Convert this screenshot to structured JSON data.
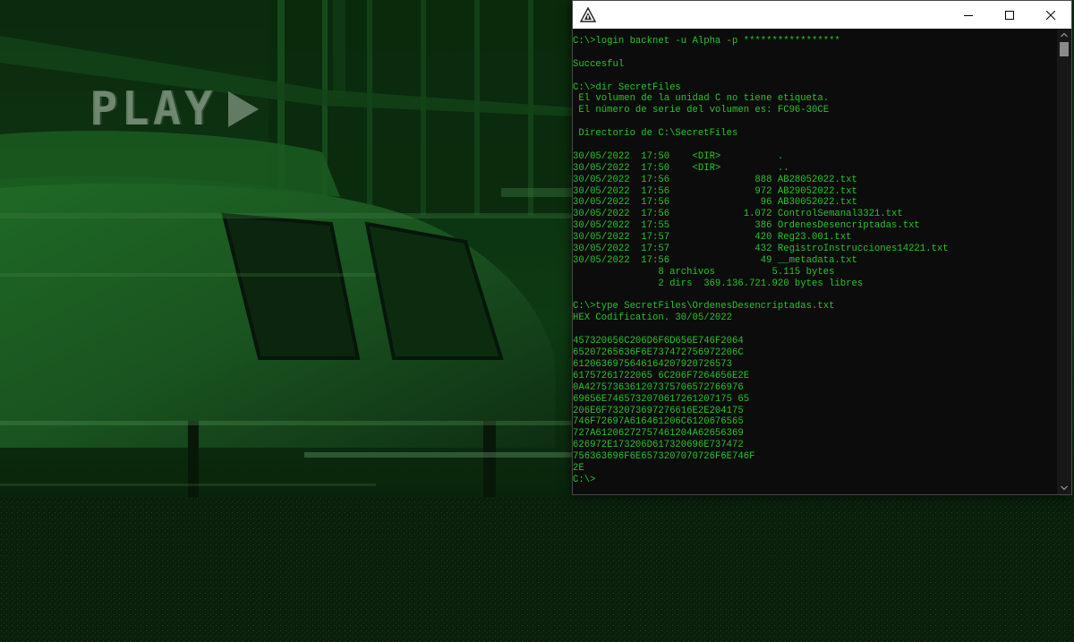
{
  "background": {
    "overlay_text": "PLAY",
    "overlay_icon": "play-triangle-icon",
    "tint": "#0b3a10"
  },
  "console": {
    "app_icon": "triangle-app-icon",
    "controls": {
      "minimize_icon": "minimize-icon",
      "maximize_icon": "maximize-icon",
      "close_icon": "close-icon"
    },
    "text_color": "#27c52b",
    "background_color": "#0c0c0c",
    "lines": [
      "C:\\>login backnet -u Alpha -p *****************",
      "",
      "Succesful",
      "",
      "C:\\>dir SecretFiles",
      " El volumen de la unidad C no tiene etiqueta.",
      " El número de serie del volumen es: FC96-30CE",
      "",
      " Directorio de C:\\SecretFiles",
      "",
      "30/05/2022  17:50    <DIR>          .",
      "30/05/2022  17:50    <DIR>          ..",
      "30/05/2022  17:56               888 AB28052022.txt",
      "30/05/2022  17:56               972 AB29052022.txt",
      "30/05/2022  17:56                96 AB30052022.txt",
      "30/05/2022  17:56             1.072 ControlSemanal3321.txt",
      "30/05/2022  17:55               386 OrdenesDesencriptadas.txt",
      "30/05/2022  17:57               420 Reg23.001.txt",
      "30/05/2022  17:57               432 RegistroInstrucciones14221.txt",
      "30/05/2022  17:56                49 __metadata.txt",
      "               8 archivos          5.115 bytes",
      "               2 dirs  369.136.721.920 bytes libres",
      "",
      "C:\\>type SecretFiles\\OrdenesDesencriptadas.txt",
      "HEX Codification. 30/05/2022",
      "",
      "457320656C206D6F6D656E746F2064",
      "65207265636F6E737472756972206C",
      "6120636975646164207920726573",
      "61757261722065 6C206F7264656E2E",
      "0A4275736361207375706572766976",
      "69656E7465732070617261207175 65",
      "206E6F732073697276616E2E204175",
      "746F72697A616461206C6120676565",
      "727A61206272757461204A62656369",
      "626972E173206D617320696E737472",
      "756363696F6E6573207070726F6E746F",
      "2E",
      "C:\\>"
    ]
  }
}
